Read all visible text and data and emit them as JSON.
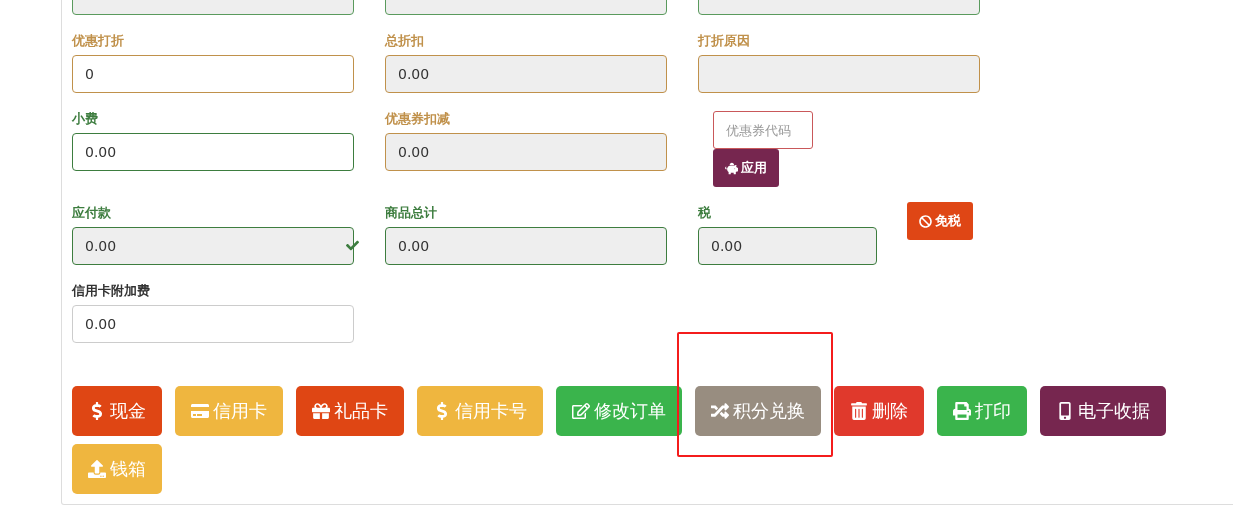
{
  "top_fields": [
    {
      "color": "#5a9a5d",
      "readonly": true
    },
    {
      "color": "#5a9a5d",
      "readonly": true
    },
    {
      "color": "#5a9a5d",
      "readonly": true
    }
  ],
  "rows": [
    {
      "cells": [
        {
          "kind": "field",
          "label": "优惠打折",
          "value": "0",
          "color": "#c0914b",
          "readonly": false
        },
        {
          "kind": "field",
          "label": "总折扣",
          "value": "0.00",
          "color": "#c0914b",
          "readonly": true
        },
        {
          "kind": "field",
          "label": "打折原因",
          "color": "#c0914b",
          "readonly": true
        }
      ]
    },
    {
      "cells": [
        {
          "kind": "field",
          "label": "小费",
          "value": "0.00",
          "color": "#3d7d3f",
          "readonly": false
        },
        {
          "kind": "field",
          "label": "优惠券扣减",
          "value": "0.00",
          "color": "#c0914b",
          "readonly": true
        },
        {
          "kind": "coupon",
          "placeholder": "优惠券代码",
          "button": "应用"
        }
      ]
    },
    {
      "cells": [
        {
          "kind": "field",
          "label": "应付款",
          "value": "0.00",
          "color": "#3d7d3f",
          "readonly": true,
          "valid": true
        },
        {
          "kind": "field",
          "label": "商品总计",
          "value": "0.00",
          "color": "#3d7d3f",
          "readonly": true
        },
        {
          "kind": "tax",
          "label": "税",
          "value": "0.00",
          "color": "#3d7d3f",
          "readonly": true,
          "button": "免税"
        }
      ]
    },
    {
      "cells": [
        {
          "kind": "field",
          "label": "信用卡附加费",
          "value": "0.00",
          "readonly": false
        }
      ]
    }
  ],
  "buttons": [
    {
      "label": "现金",
      "color": "#df4614",
      "highlighted": false
    },
    {
      "label": "信用卡",
      "color": "#efb63f",
      "highlighted": false
    },
    {
      "label": "礼品卡",
      "color": "#df4614",
      "highlighted": false
    },
    {
      "label": "信用卡号",
      "color": "#efb63f",
      "highlighted": false
    },
    {
      "label": "修改订单",
      "color": "#3ab44c",
      "highlighted": false
    },
    {
      "label": "积分兑换",
      "color": "#988d80",
      "highlighted": true
    },
    {
      "label": "删除",
      "color": "#e0392c",
      "highlighted": false
    },
    {
      "label": "打印",
      "color": "#3ab44c",
      "highlighted": false
    },
    {
      "label": "电子收据",
      "color": "#76264f",
      "highlighted": false
    },
    {
      "label": "钱箱",
      "color": "#efb63f",
      "highlighted": false
    }
  ]
}
